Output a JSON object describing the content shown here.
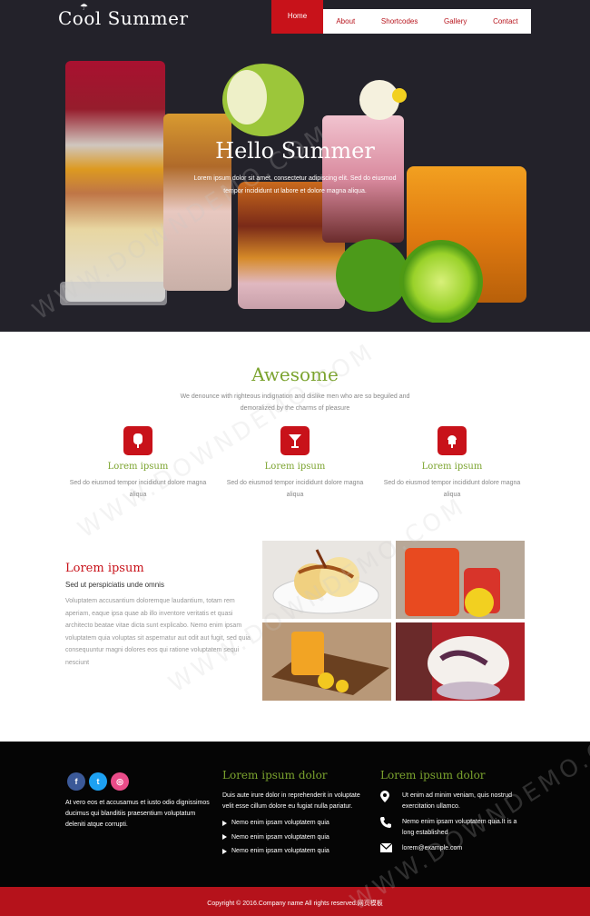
{
  "header": {
    "logo": "Cool Summer",
    "nav": [
      "Home",
      "About",
      "Shortcodes",
      "Gallery",
      "Contact"
    ]
  },
  "hero": {
    "title": "Hello Summer",
    "text": "Lorem ipsum dolor sit amet, consectetur adipiscing elit. Sed do eiusmod tempor incididunt ut labore et dolore magna aliqua."
  },
  "awesome": {
    "title": "Awesome",
    "text": "We denounce with righteous indignation and dislike men who are so beguiled and demoralized by the charms of pleasure",
    "features": [
      {
        "icon": "popsicle-icon",
        "title": "Lorem ipsum",
        "text": "Sed do eiusmod tempor incididunt dolore magna aliqua"
      },
      {
        "icon": "cocktail-icon",
        "title": "Lorem ipsum",
        "text": "Sed do eiusmod tempor incididunt dolore magna aliqua"
      },
      {
        "icon": "ice-cream-icon",
        "title": "Lorem ipsum",
        "text": "Sed do eiusmod tempor incididunt dolore magna aliqua"
      }
    ]
  },
  "about": {
    "title": "Lorem ipsum",
    "subtitle": "Sed ut perspiciatis unde omnis",
    "text": "Voluptatem accusantium doloremque laudantium, totam rem aperiam, eaque ipsa quae ab illo inventore veritatis et quasi architecto beatae vitae dicta sunt explicabo. Nemo enim ipsam voluptatem quia voluptas sit aspernatur aut odit aut fugit, sed quia consequuntur magni dolores eos qui ratione voluptatem sequi nesciunt"
  },
  "footer": {
    "about": "At vero eos et accusamus et iusto odio dignissimos ducimus qui blanditiis praesentium voluptatum deleniti atque corrupti.",
    "col2_title": "Lorem ipsum dolor",
    "col2_text": "Duis aute irure dolor in reprehenderit in voluptate velit esse cillum dolore eu fugiat nulla pariatur.",
    "col2_list": [
      "Nemo enim ipsam voluptatem quia",
      "Nemo enim ipsam voluptatem quia",
      "Nemo enim ipsam voluptatem quia"
    ],
    "col3_title": "Lorem ipsum dolor",
    "address": "Ut enim ad minim veniam, quis nostrud exercitation ullamco.",
    "phone": "Nemo enim ipsam voluptatem quia.It is a long established",
    "email": "lorem@example.com",
    "copyright": "Copyright © 2016.Company name All rights reserved.网页模板"
  },
  "watermark": "WWW.DOWNDEMO.COM",
  "colors": {
    "accent_red": "#c8121a",
    "accent_green": "#7ba32e",
    "hero_bg": "#23222a",
    "footer_bg": "#050505"
  }
}
